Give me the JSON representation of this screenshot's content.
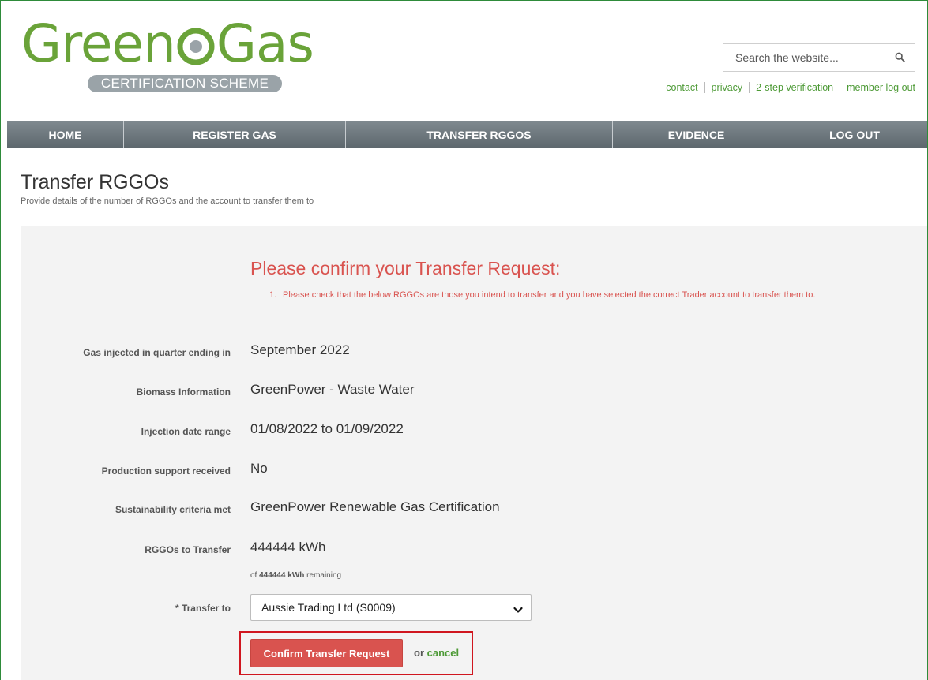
{
  "brand": {
    "logo_left": "Green",
    "logo_right": "Gas",
    "logo_sub": "CERTIFICATION SCHEME",
    "green": "#6aa339",
    "grey": "#9aa3a8"
  },
  "search": {
    "placeholder": "Search the website...",
    "icon": "search-icon"
  },
  "util_links": [
    {
      "label": "contact"
    },
    {
      "label": "privacy"
    },
    {
      "label": "2-step verification"
    },
    {
      "label": "member log out"
    }
  ],
  "nav": [
    {
      "label": "HOME"
    },
    {
      "label": "REGISTER GAS"
    },
    {
      "label": "TRANSFER RGGOS"
    },
    {
      "label": "EVIDENCE"
    },
    {
      "label": "LOG OUT"
    }
  ],
  "page": {
    "title": "Transfer RGGOs",
    "subtitle": "Provide details of the number of RGGOs and the account to transfer them to"
  },
  "confirm": {
    "title": "Please confirm your Transfer Request:",
    "note_number": "1.",
    "note_text": "Please check that the below RGGOs are those you intend to transfer and you have selected the correct Trader account to transfer them to."
  },
  "details": [
    {
      "label": "Gas injected in quarter ending in",
      "value": "September 2022"
    },
    {
      "label": "Biomass Information",
      "value": "GreenPower - Waste Water"
    },
    {
      "label": "Injection date range",
      "value": "01/08/2022 to 01/09/2022"
    },
    {
      "label": "Production support received",
      "value": "No"
    },
    {
      "label": "Sustainability criteria met",
      "value": "GreenPower Renewable Gas Certification"
    },
    {
      "label": "RGGOs to Transfer",
      "value": "444444 kWh"
    }
  ],
  "remaining": {
    "prefix": "of",
    "amount": "444444 kWh",
    "suffix": "remaining"
  },
  "transfer_to": {
    "label": "* Transfer to",
    "selected": "Aussie Trading Ltd (S0009)"
  },
  "actions": {
    "confirm_label": "Confirm Transfer Request",
    "or_text": "or",
    "cancel_label": "cancel",
    "accent": "#d9534f",
    "highlight": "#d0161f"
  }
}
